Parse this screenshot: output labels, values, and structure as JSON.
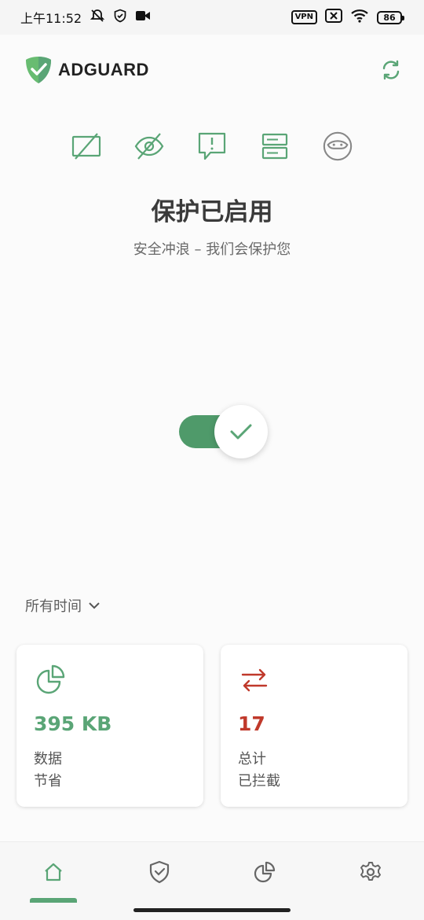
{
  "status_bar": {
    "time": "上午11:52",
    "vpn": "VPN",
    "battery": "86"
  },
  "header": {
    "app_name": "ADGUARD"
  },
  "features": [
    {
      "icon": "ad-blocking-icon"
    },
    {
      "icon": "tracking-protection-icon"
    },
    {
      "icon": "annoyance-blocking-icon"
    },
    {
      "icon": "dns-protection-icon"
    },
    {
      "icon": "stealth-mode-icon"
    }
  ],
  "protection": {
    "title": "保护已启用",
    "subtitle": "安全冲浪 – 我们会保护您",
    "enabled": true
  },
  "period": {
    "label": "所有时间"
  },
  "stats": {
    "saved": {
      "value": "395 KB",
      "label_line1": "数据",
      "label_line2": "节省",
      "color": "#5aa576"
    },
    "blocked": {
      "value": "17",
      "label_line1": "总计",
      "label_line2": "已拦截",
      "color": "#c0392b"
    }
  },
  "colors": {
    "accent": "#5aa576",
    "danger": "#c0392b"
  },
  "bottom_nav": [
    {
      "icon": "home-icon",
      "active": true
    },
    {
      "icon": "protection-shield-icon",
      "active": false
    },
    {
      "icon": "statistics-icon",
      "active": false
    },
    {
      "icon": "settings-icon",
      "active": false
    }
  ]
}
